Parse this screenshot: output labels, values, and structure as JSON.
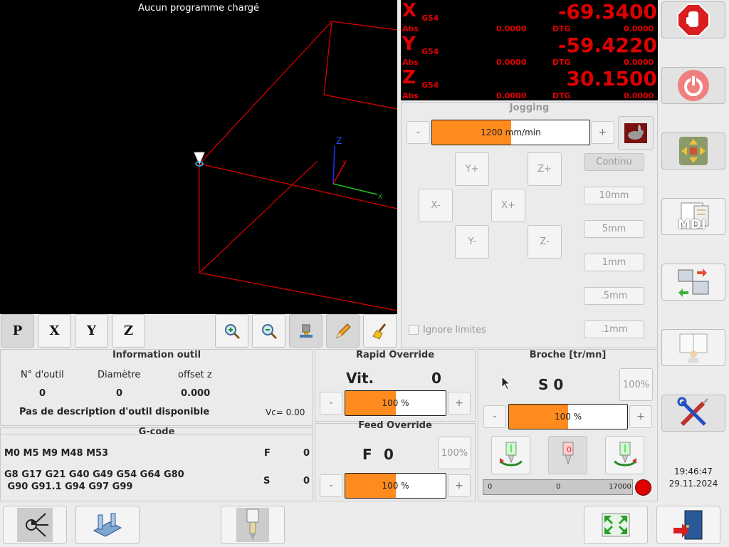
{
  "preview": {
    "title": "Aucun programme chargé",
    "axis_labels": {
      "z": "Z",
      "y": "Y",
      "x": "X"
    }
  },
  "view_buttons": [
    "P",
    "X",
    "Y",
    "Z"
  ],
  "dro": {
    "axes": [
      {
        "letter": "X",
        "wcs": "G54",
        "value": "-69.3400",
        "abs_label": "Abs",
        "abs": "0.0000",
        "dtg_label": "DTG",
        "dtg": "0.0000"
      },
      {
        "letter": "Y",
        "wcs": "G54",
        "value": "-59.4220",
        "abs_label": "Abs",
        "abs": "0.0000",
        "dtg_label": "DTG",
        "dtg": "0.0000"
      },
      {
        "letter": "Z",
        "wcs": "G54",
        "value": "30.1500",
        "abs_label": "Abs",
        "abs": "0.0000",
        "dtg_label": "DTG",
        "dtg": "0.0000"
      }
    ]
  },
  "jogging": {
    "title": "Jogging",
    "minus": "-",
    "plus": "+",
    "speed_label": "1200 mm/min",
    "speed_fraction": 0.5,
    "buttons": {
      "y_plus": "Y+",
      "z_plus": "Z+",
      "x_minus": "X-",
      "x_plus": "X+",
      "y_minus": "Y-",
      "z_minus": "Z-"
    },
    "increments": [
      "Continu",
      "10mm",
      "5mm",
      "1mm",
      ".5mm",
      ".1mm"
    ],
    "ignore_limits": "Ignore limites"
  },
  "tool_info": {
    "title": "Information outil",
    "headers": [
      "N° d'outil",
      "Diamètre",
      "offset z"
    ],
    "values": [
      "0",
      "0",
      "0.000"
    ],
    "description": "Pas de description d'outil disponible",
    "vc": "Vc= 0.00"
  },
  "rapid": {
    "title": "Rapid Override",
    "speed_label": "Vit.",
    "speed_value": "0",
    "percent": "100 %",
    "fraction": 0.5,
    "minus": "-",
    "plus": "+"
  },
  "feed": {
    "title": "Feed Override",
    "f_label": "F",
    "f_value": "0",
    "reset": "100%",
    "percent": "100 %",
    "fraction": 0.5,
    "minus": "-",
    "plus": "+"
  },
  "gcode": {
    "title": "G-code",
    "mcodes": "M0 M5 M9 M48 M53",
    "gcodes_line1": "G8 G17 G21 G40 G49 G54 G64 G80",
    "gcodes_line2": " G90 G91.1 G94 G97 G99",
    "f_label": "F",
    "f_value": "0",
    "s_label": "S",
    "s_value": "0"
  },
  "spindle": {
    "title": "Broche [tr/mn]",
    "s_text": "S 0",
    "reset": "100%",
    "percent": "100 %",
    "fraction": 0.5,
    "minus": "-",
    "plus": "+",
    "stop_label": "0",
    "scale_min": "0",
    "scale_mid": "0",
    "scale_max": "17000",
    "indicator_color": "#e00000"
  },
  "clock": {
    "time": "19:46:47",
    "date": "29.11.2024"
  },
  "sidebar": {
    "mdi_label": "MDI"
  },
  "colors": {
    "accent": "#ff8a1e",
    "dro_red": "#e00000"
  }
}
